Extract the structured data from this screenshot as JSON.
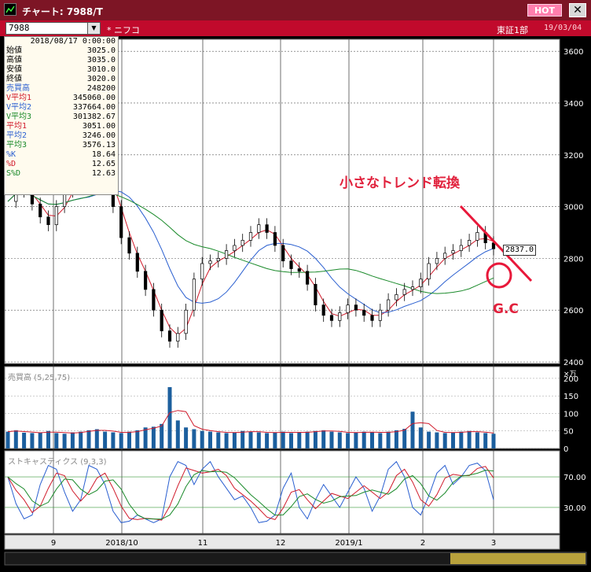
{
  "window": {
    "title": "チャート: 7988/T",
    "hot_label": "HOT",
    "close_label": "✕"
  },
  "toolbar": {
    "symbol_value": "7988",
    "company_name": "* ニフコ",
    "market": "東証1部",
    "date": "19/03/04"
  },
  "info": {
    "datetime": "2018/08/17 0:00:00",
    "rows": [
      {
        "label": "始値",
        "value": "3025.0",
        "color": "#000000"
      },
      {
        "label": "高値",
        "value": "3035.0",
        "color": "#000000"
      },
      {
        "label": "安値",
        "value": "3010.0",
        "color": "#000000"
      },
      {
        "label": "終値",
        "value": "3020.0",
        "color": "#000000"
      },
      {
        "label": "売買高",
        "value": "248200",
        "color": "#2a5fd0"
      },
      {
        "label": "V平均1",
        "value": "345060.00",
        "color": "#d01a2a"
      },
      {
        "label": "V平均2",
        "value": "337664.00",
        "color": "#2a5fd0"
      },
      {
        "label": "V平均3",
        "value": "301382.67",
        "color": "#1a8a2a"
      },
      {
        "label": "平均1",
        "value": "3051.00",
        "color": "#d01a2a"
      },
      {
        "label": "平均2",
        "value": "3246.00",
        "color": "#2a5fd0"
      },
      {
        "label": "平均3",
        "value": "3576.13",
        "color": "#1a8a2a"
      },
      {
        "label": "%K",
        "value": "18.64",
        "color": "#2a5fd0"
      },
      {
        "label": "%D",
        "value": "12.65",
        "color": "#d01a2a"
      },
      {
        "label": "S%D",
        "value": "12.63",
        "color": "#1a8a2a"
      }
    ]
  },
  "annotations": {
    "trend_text": "小さなトレンド転換",
    "gc_text": "G.C",
    "last_price": "2837.0"
  },
  "indicators": {
    "volume_label": "売買高 (5,25,75)",
    "stoch_label": "ストキャスティクス (9,3,3)",
    "volume_unit": "×万"
  },
  "chart_data": {
    "type": "candlestick",
    "date_range": [
      "2018/08/17",
      "2019/03/04"
    ],
    "x_tick_labels": [
      "9",
      "2018/10",
      "11",
      "12",
      "2019/1",
      "2",
      "3"
    ],
    "price_axis": {
      "ticks": [
        "3600",
        "3400",
        "3200",
        "3000",
        "2800",
        "2600",
        "2400"
      ],
      "ylim": [
        2400,
        3640
      ]
    },
    "volume_axis": {
      "ticks": [
        "200",
        "150",
        "100",
        "50",
        "0"
      ],
      "unit": "×万"
    },
    "stoch_axis": {
      "ticks": [
        "70.00",
        "30.00"
      ]
    },
    "close_path": [
      3020,
      3080,
      3060,
      3010,
      2960,
      2930,
      3000,
      3060,
      3100,
      3090,
      3120,
      3150,
      3110,
      3000,
      2880,
      2820,
      2750,
      2680,
      2600,
      2520,
      2480,
      2510,
      2600,
      2720,
      2780,
      2790,
      2800,
      2830,
      2850,
      2870,
      2900,
      2930,
      2900,
      2850,
      2790,
      2760,
      2750,
      2700,
      2620,
      2580,
      2560,
      2590,
      2620,
      2600,
      2580,
      2560,
      2600,
      2640,
      2660,
      2680,
      2690,
      2720,
      2780,
      2800,
      2820,
      2830,
      2850,
      2870,
      2900,
      2860,
      2837
    ],
    "volume_path": [
      48,
      52,
      45,
      44,
      46,
      50,
      44,
      42,
      46,
      48,
      52,
      55,
      48,
      46,
      44,
      48,
      52,
      60,
      62,
      70,
      175,
      80,
      60,
      55,
      50,
      48,
      46,
      44,
      46,
      50,
      48,
      46,
      44,
      46,
      48,
      44,
      46,
      48,
      50,
      52,
      48,
      46,
      44,
      46,
      48,
      46,
      44,
      48,
      52,
      56,
      105,
      60,
      48,
      46,
      44,
      46,
      48,
      50,
      46,
      44,
      42
    ],
    "stoch_k_path": [
      70,
      35,
      15,
      20,
      60,
      85,
      80,
      50,
      25,
      40,
      85,
      80,
      60,
      25,
      10,
      12,
      20,
      15,
      10,
      15,
      70,
      90,
      85,
      60,
      80,
      90,
      70,
      55,
      40,
      45,
      30,
      10,
      12,
      20,
      55,
      75,
      30,
      15,
      40,
      60,
      45,
      30,
      50,
      70,
      55,
      25,
      45,
      80,
      90,
      70,
      30,
      20,
      45,
      75,
      85,
      60,
      70,
      85,
      88,
      78,
      40
    ]
  }
}
